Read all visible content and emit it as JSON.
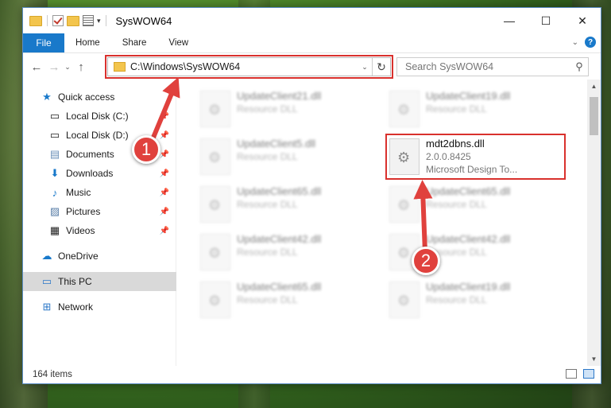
{
  "window": {
    "title": "SysWOW64",
    "buttons": {
      "minimize": "—",
      "maximize": "☐",
      "close": "✕"
    }
  },
  "ribbon": {
    "tabs": [
      {
        "label": "File"
      },
      {
        "label": "Home"
      },
      {
        "label": "Share"
      },
      {
        "label": "View"
      }
    ]
  },
  "address": {
    "path": "C:\\Windows\\SysWOW64"
  },
  "search": {
    "placeholder": "Search SysWOW64"
  },
  "sidebar": {
    "quick_access": "Quick access",
    "items": [
      {
        "label": "Local Disk (C:)"
      },
      {
        "label": "Local Disk (D:)"
      },
      {
        "label": "Documents"
      },
      {
        "label": "Downloads"
      },
      {
        "label": "Music"
      },
      {
        "label": "Pictures"
      },
      {
        "label": "Videos"
      }
    ],
    "onedrive": "OneDrive",
    "this_pc": "This PC",
    "network": "Network"
  },
  "files": [
    {
      "name": "UpdateClient21.dll",
      "type": "Resource DLL"
    },
    {
      "name": "UpdateClient19.dll",
      "type": "Resource DLL"
    },
    {
      "name": "UpdateClient5.dll",
      "type": "Resource DLL"
    },
    {
      "name": "mdt2dbns.dll",
      "version": "2.0.0.8425",
      "company": "Microsoft Design To..."
    },
    {
      "name": "UpdateClient65.dll",
      "type": "Resource DLL"
    },
    {
      "name": "UpdateClient65.dll",
      "type": "Resource DLL"
    },
    {
      "name": "UpdateClient42.dll",
      "type": "Resource DLL"
    },
    {
      "name": "UpdateClient42.dll",
      "type": "Resource DLL"
    },
    {
      "name": "UpdateClient65.dll",
      "type": "Resource DLL"
    },
    {
      "name": "UpdateClient19.dll",
      "type": "Resource DLL"
    }
  ],
  "status": {
    "item_count": "164 items"
  },
  "callouts": {
    "one": "1",
    "two": "2"
  },
  "colors": {
    "accent": "#1979ca",
    "highlight": "#d9312d"
  }
}
